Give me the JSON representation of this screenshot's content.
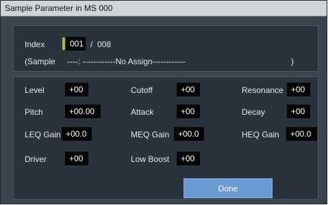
{
  "title": "Sample Parameter in MS 000",
  "index": {
    "label": "Index",
    "value": "001",
    "separator": "/",
    "total": "008"
  },
  "sample": {
    "label": "(Sample",
    "value": "----: ------------No Assign------------",
    "close": ")"
  },
  "params": {
    "level": {
      "label": "Level",
      "value": "+00"
    },
    "cutoff": {
      "label": "Cutoff",
      "value": "+00"
    },
    "resonance": {
      "label": "Resonance",
      "value": "+00"
    },
    "pitch": {
      "label": "Pitch",
      "value": "+00.00"
    },
    "attack": {
      "label": "Attack",
      "value": "+00"
    },
    "decay": {
      "label": "Decay",
      "value": "+00"
    },
    "leq_gain": {
      "label": "LEQ Gain",
      "value": "+00.0"
    },
    "meq_gain": {
      "label": "MEQ Gain",
      "value": "+00.0"
    },
    "heq_gain": {
      "label": "HEQ Gain",
      "value": "+00.0"
    },
    "driver": {
      "label": "Driver",
      "value": "+00"
    },
    "low_boost": {
      "label": "Low Boost",
      "value": "+00"
    }
  },
  "done_label": "Done",
  "colors": {
    "accent": "#97c23c",
    "button": "#6b99d1",
    "panel": "#2a333d",
    "dialog": "#3b4550"
  }
}
